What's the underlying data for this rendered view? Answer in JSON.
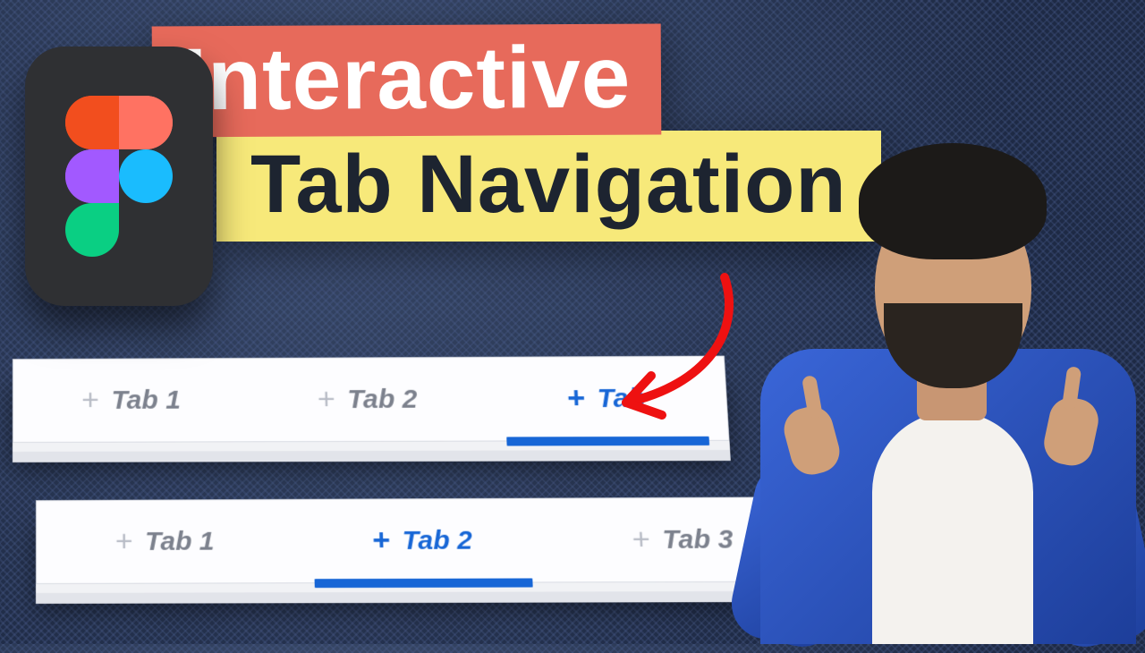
{
  "title": {
    "line1": "Interactive",
    "line2": "Tab Navigation"
  },
  "colors": {
    "accent_red": "#e76a5b",
    "accent_yellow": "#f7e97a",
    "accent_blue": "#1766d6",
    "figma_orange": "#f24e1e",
    "figma_purple": "#a259ff",
    "figma_blue": "#1abcfe",
    "figma_green": "#0acf83",
    "figma_red": "#ff7262"
  },
  "bars": {
    "top": {
      "tabs": [
        {
          "label": "Tab 1",
          "active": false
        },
        {
          "label": "Tab 2",
          "active": false
        },
        {
          "label": "Tab",
          "active": true
        }
      ]
    },
    "bottom": {
      "tabs": [
        {
          "label": "Tab 1",
          "active": false
        },
        {
          "label": "Tab 2",
          "active": true
        },
        {
          "label": "Tab 3",
          "active": false
        }
      ]
    }
  },
  "icons": {
    "plus": "+"
  }
}
